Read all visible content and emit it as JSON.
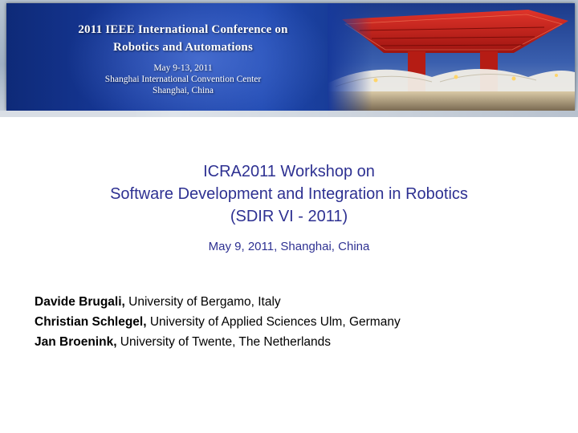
{
  "banner": {
    "conference_line1": "2011 IEEE International Conference on",
    "conference_line2": "Robotics and Automations",
    "dates": "May 9-13, 2011",
    "venue": "Shanghai International Convention Center",
    "city": "Shanghai, China",
    "photo_icon": "china-pavilion-photo"
  },
  "title": {
    "line1": "ICRA2011 Workshop on",
    "line2": "Software Development and Integration in Robotics",
    "line3": "(SDIR VI - 2011)"
  },
  "event_date_place": "May 9, 2011, Shanghai, China",
  "authors": [
    {
      "name": "Davide Brugali,",
      "affiliation": " University of Bergamo, Italy"
    },
    {
      "name": "Christian Schlegel,",
      "affiliation": " University of Applied Sciences Ulm, Germany"
    },
    {
      "name": "Jan Broenink,",
      "affiliation": " University of Twente, The Netherlands"
    }
  ],
  "colors": {
    "title": "#2e3192",
    "banner_blue": "#1d46ae",
    "pavilion_red": "#c8201a"
  }
}
